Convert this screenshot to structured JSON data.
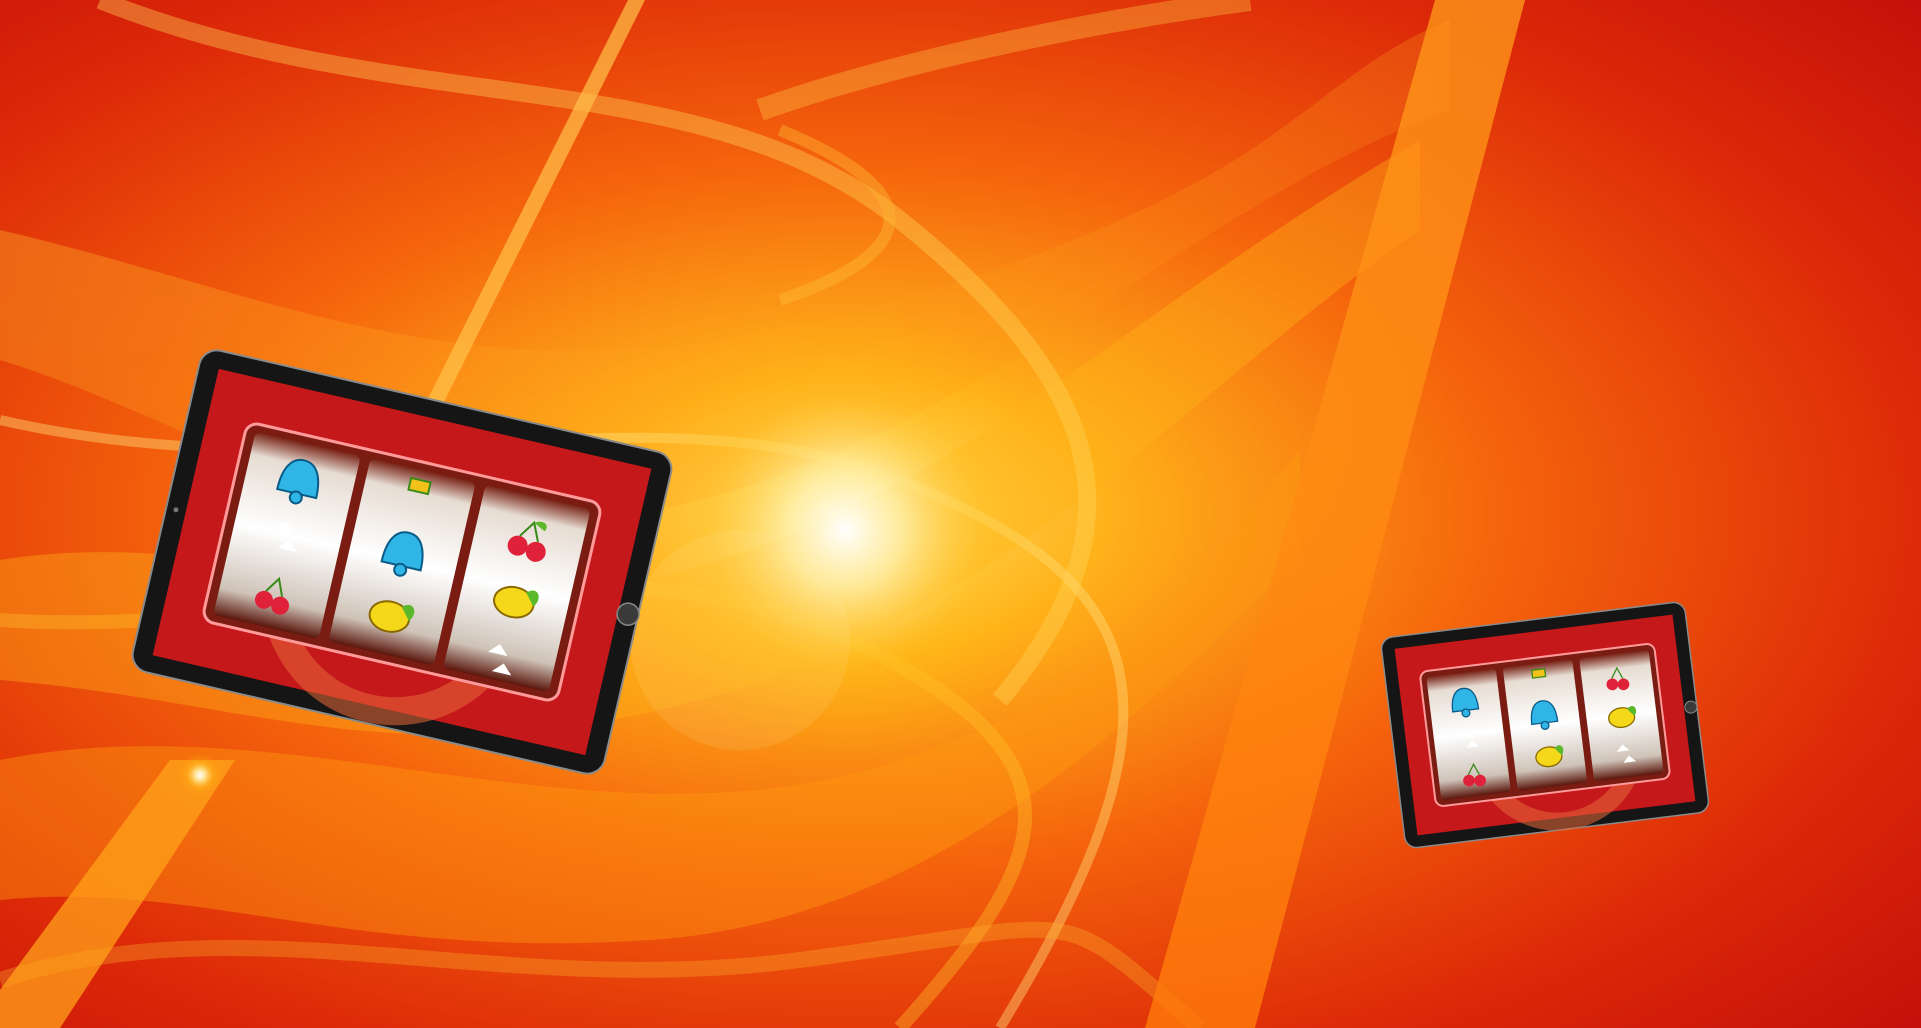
{
  "scene": {
    "description_free": true,
    "colors": {
      "background_red": "#d3150a",
      "flame_orange": "#ff8a10",
      "flame_yellow": "#ffc21a",
      "glow_white": "#fff6c8",
      "tablet_bezel": "#141414",
      "screen_red": "#c81a16",
      "reel_silver": "#e9e2da",
      "reel_dark": "#6b1a10"
    }
  },
  "tablets": [
    {
      "id": "large",
      "reels": [
        [
          "bell",
          "arrows",
          "cherry"
        ],
        [
          "bar",
          "bell",
          "lemon"
        ],
        [
          "cherry",
          "lemon",
          "arrows"
        ]
      ]
    },
    {
      "id": "small",
      "reels": [
        [
          "bell",
          "arrows",
          "cherry"
        ],
        [
          "bar",
          "bell",
          "lemon"
        ],
        [
          "cherry",
          "lemon",
          "arrows"
        ]
      ]
    }
  ]
}
